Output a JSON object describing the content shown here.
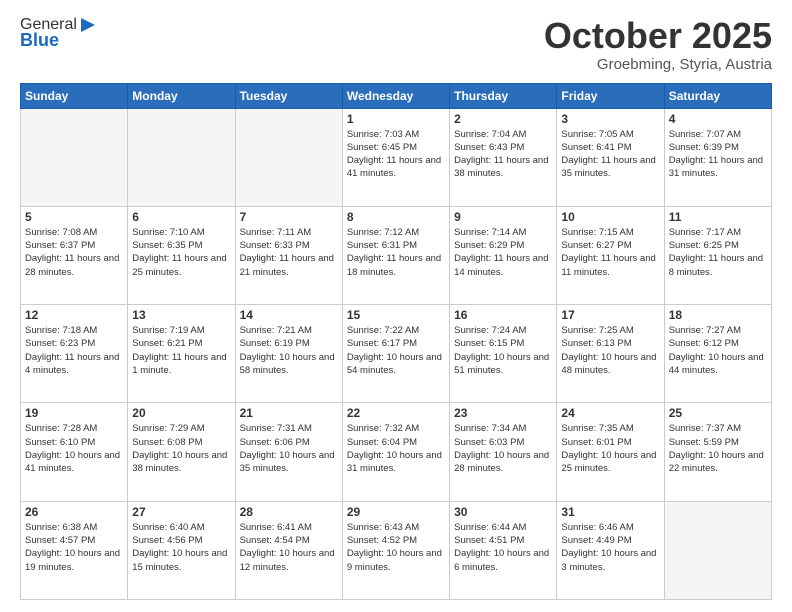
{
  "header": {
    "logo_general": "General",
    "logo_blue": "Blue",
    "month_title": "October 2025",
    "subtitle": "Groebming, Styria, Austria"
  },
  "weekdays": [
    "Sunday",
    "Monday",
    "Tuesday",
    "Wednesday",
    "Thursday",
    "Friday",
    "Saturday"
  ],
  "weeks": [
    [
      {
        "day": "",
        "info": ""
      },
      {
        "day": "",
        "info": ""
      },
      {
        "day": "",
        "info": ""
      },
      {
        "day": "1",
        "info": "Sunrise: 7:03 AM\nSunset: 6:45 PM\nDaylight: 11 hours\nand 41 minutes."
      },
      {
        "day": "2",
        "info": "Sunrise: 7:04 AM\nSunset: 6:43 PM\nDaylight: 11 hours\nand 38 minutes."
      },
      {
        "day": "3",
        "info": "Sunrise: 7:05 AM\nSunset: 6:41 PM\nDaylight: 11 hours\nand 35 minutes."
      },
      {
        "day": "4",
        "info": "Sunrise: 7:07 AM\nSunset: 6:39 PM\nDaylight: 11 hours\nand 31 minutes."
      }
    ],
    [
      {
        "day": "5",
        "info": "Sunrise: 7:08 AM\nSunset: 6:37 PM\nDaylight: 11 hours\nand 28 minutes."
      },
      {
        "day": "6",
        "info": "Sunrise: 7:10 AM\nSunset: 6:35 PM\nDaylight: 11 hours\nand 25 minutes."
      },
      {
        "day": "7",
        "info": "Sunrise: 7:11 AM\nSunset: 6:33 PM\nDaylight: 11 hours\nand 21 minutes."
      },
      {
        "day": "8",
        "info": "Sunrise: 7:12 AM\nSunset: 6:31 PM\nDaylight: 11 hours\nand 18 minutes."
      },
      {
        "day": "9",
        "info": "Sunrise: 7:14 AM\nSunset: 6:29 PM\nDaylight: 11 hours\nand 14 minutes."
      },
      {
        "day": "10",
        "info": "Sunrise: 7:15 AM\nSunset: 6:27 PM\nDaylight: 11 hours\nand 11 minutes."
      },
      {
        "day": "11",
        "info": "Sunrise: 7:17 AM\nSunset: 6:25 PM\nDaylight: 11 hours\nand 8 minutes."
      }
    ],
    [
      {
        "day": "12",
        "info": "Sunrise: 7:18 AM\nSunset: 6:23 PM\nDaylight: 11 hours\nand 4 minutes."
      },
      {
        "day": "13",
        "info": "Sunrise: 7:19 AM\nSunset: 6:21 PM\nDaylight: 11 hours\nand 1 minute."
      },
      {
        "day": "14",
        "info": "Sunrise: 7:21 AM\nSunset: 6:19 PM\nDaylight: 10 hours\nand 58 minutes."
      },
      {
        "day": "15",
        "info": "Sunrise: 7:22 AM\nSunset: 6:17 PM\nDaylight: 10 hours\nand 54 minutes."
      },
      {
        "day": "16",
        "info": "Sunrise: 7:24 AM\nSunset: 6:15 PM\nDaylight: 10 hours\nand 51 minutes."
      },
      {
        "day": "17",
        "info": "Sunrise: 7:25 AM\nSunset: 6:13 PM\nDaylight: 10 hours\nand 48 minutes."
      },
      {
        "day": "18",
        "info": "Sunrise: 7:27 AM\nSunset: 6:12 PM\nDaylight: 10 hours\nand 44 minutes."
      }
    ],
    [
      {
        "day": "19",
        "info": "Sunrise: 7:28 AM\nSunset: 6:10 PM\nDaylight: 10 hours\nand 41 minutes."
      },
      {
        "day": "20",
        "info": "Sunrise: 7:29 AM\nSunset: 6:08 PM\nDaylight: 10 hours\nand 38 minutes."
      },
      {
        "day": "21",
        "info": "Sunrise: 7:31 AM\nSunset: 6:06 PM\nDaylight: 10 hours\nand 35 minutes."
      },
      {
        "day": "22",
        "info": "Sunrise: 7:32 AM\nSunset: 6:04 PM\nDaylight: 10 hours\nand 31 minutes."
      },
      {
        "day": "23",
        "info": "Sunrise: 7:34 AM\nSunset: 6:03 PM\nDaylight: 10 hours\nand 28 minutes."
      },
      {
        "day": "24",
        "info": "Sunrise: 7:35 AM\nSunset: 6:01 PM\nDaylight: 10 hours\nand 25 minutes."
      },
      {
        "day": "25",
        "info": "Sunrise: 7:37 AM\nSunset: 5:59 PM\nDaylight: 10 hours\nand 22 minutes."
      }
    ],
    [
      {
        "day": "26",
        "info": "Sunrise: 6:38 AM\nSunset: 4:57 PM\nDaylight: 10 hours\nand 19 minutes."
      },
      {
        "day": "27",
        "info": "Sunrise: 6:40 AM\nSunset: 4:56 PM\nDaylight: 10 hours\nand 15 minutes."
      },
      {
        "day": "28",
        "info": "Sunrise: 6:41 AM\nSunset: 4:54 PM\nDaylight: 10 hours\nand 12 minutes."
      },
      {
        "day": "29",
        "info": "Sunrise: 6:43 AM\nSunset: 4:52 PM\nDaylight: 10 hours\nand 9 minutes."
      },
      {
        "day": "30",
        "info": "Sunrise: 6:44 AM\nSunset: 4:51 PM\nDaylight: 10 hours\nand 6 minutes."
      },
      {
        "day": "31",
        "info": "Sunrise: 6:46 AM\nSunset: 4:49 PM\nDaylight: 10 hours\nand 3 minutes."
      },
      {
        "day": "",
        "info": ""
      }
    ]
  ]
}
